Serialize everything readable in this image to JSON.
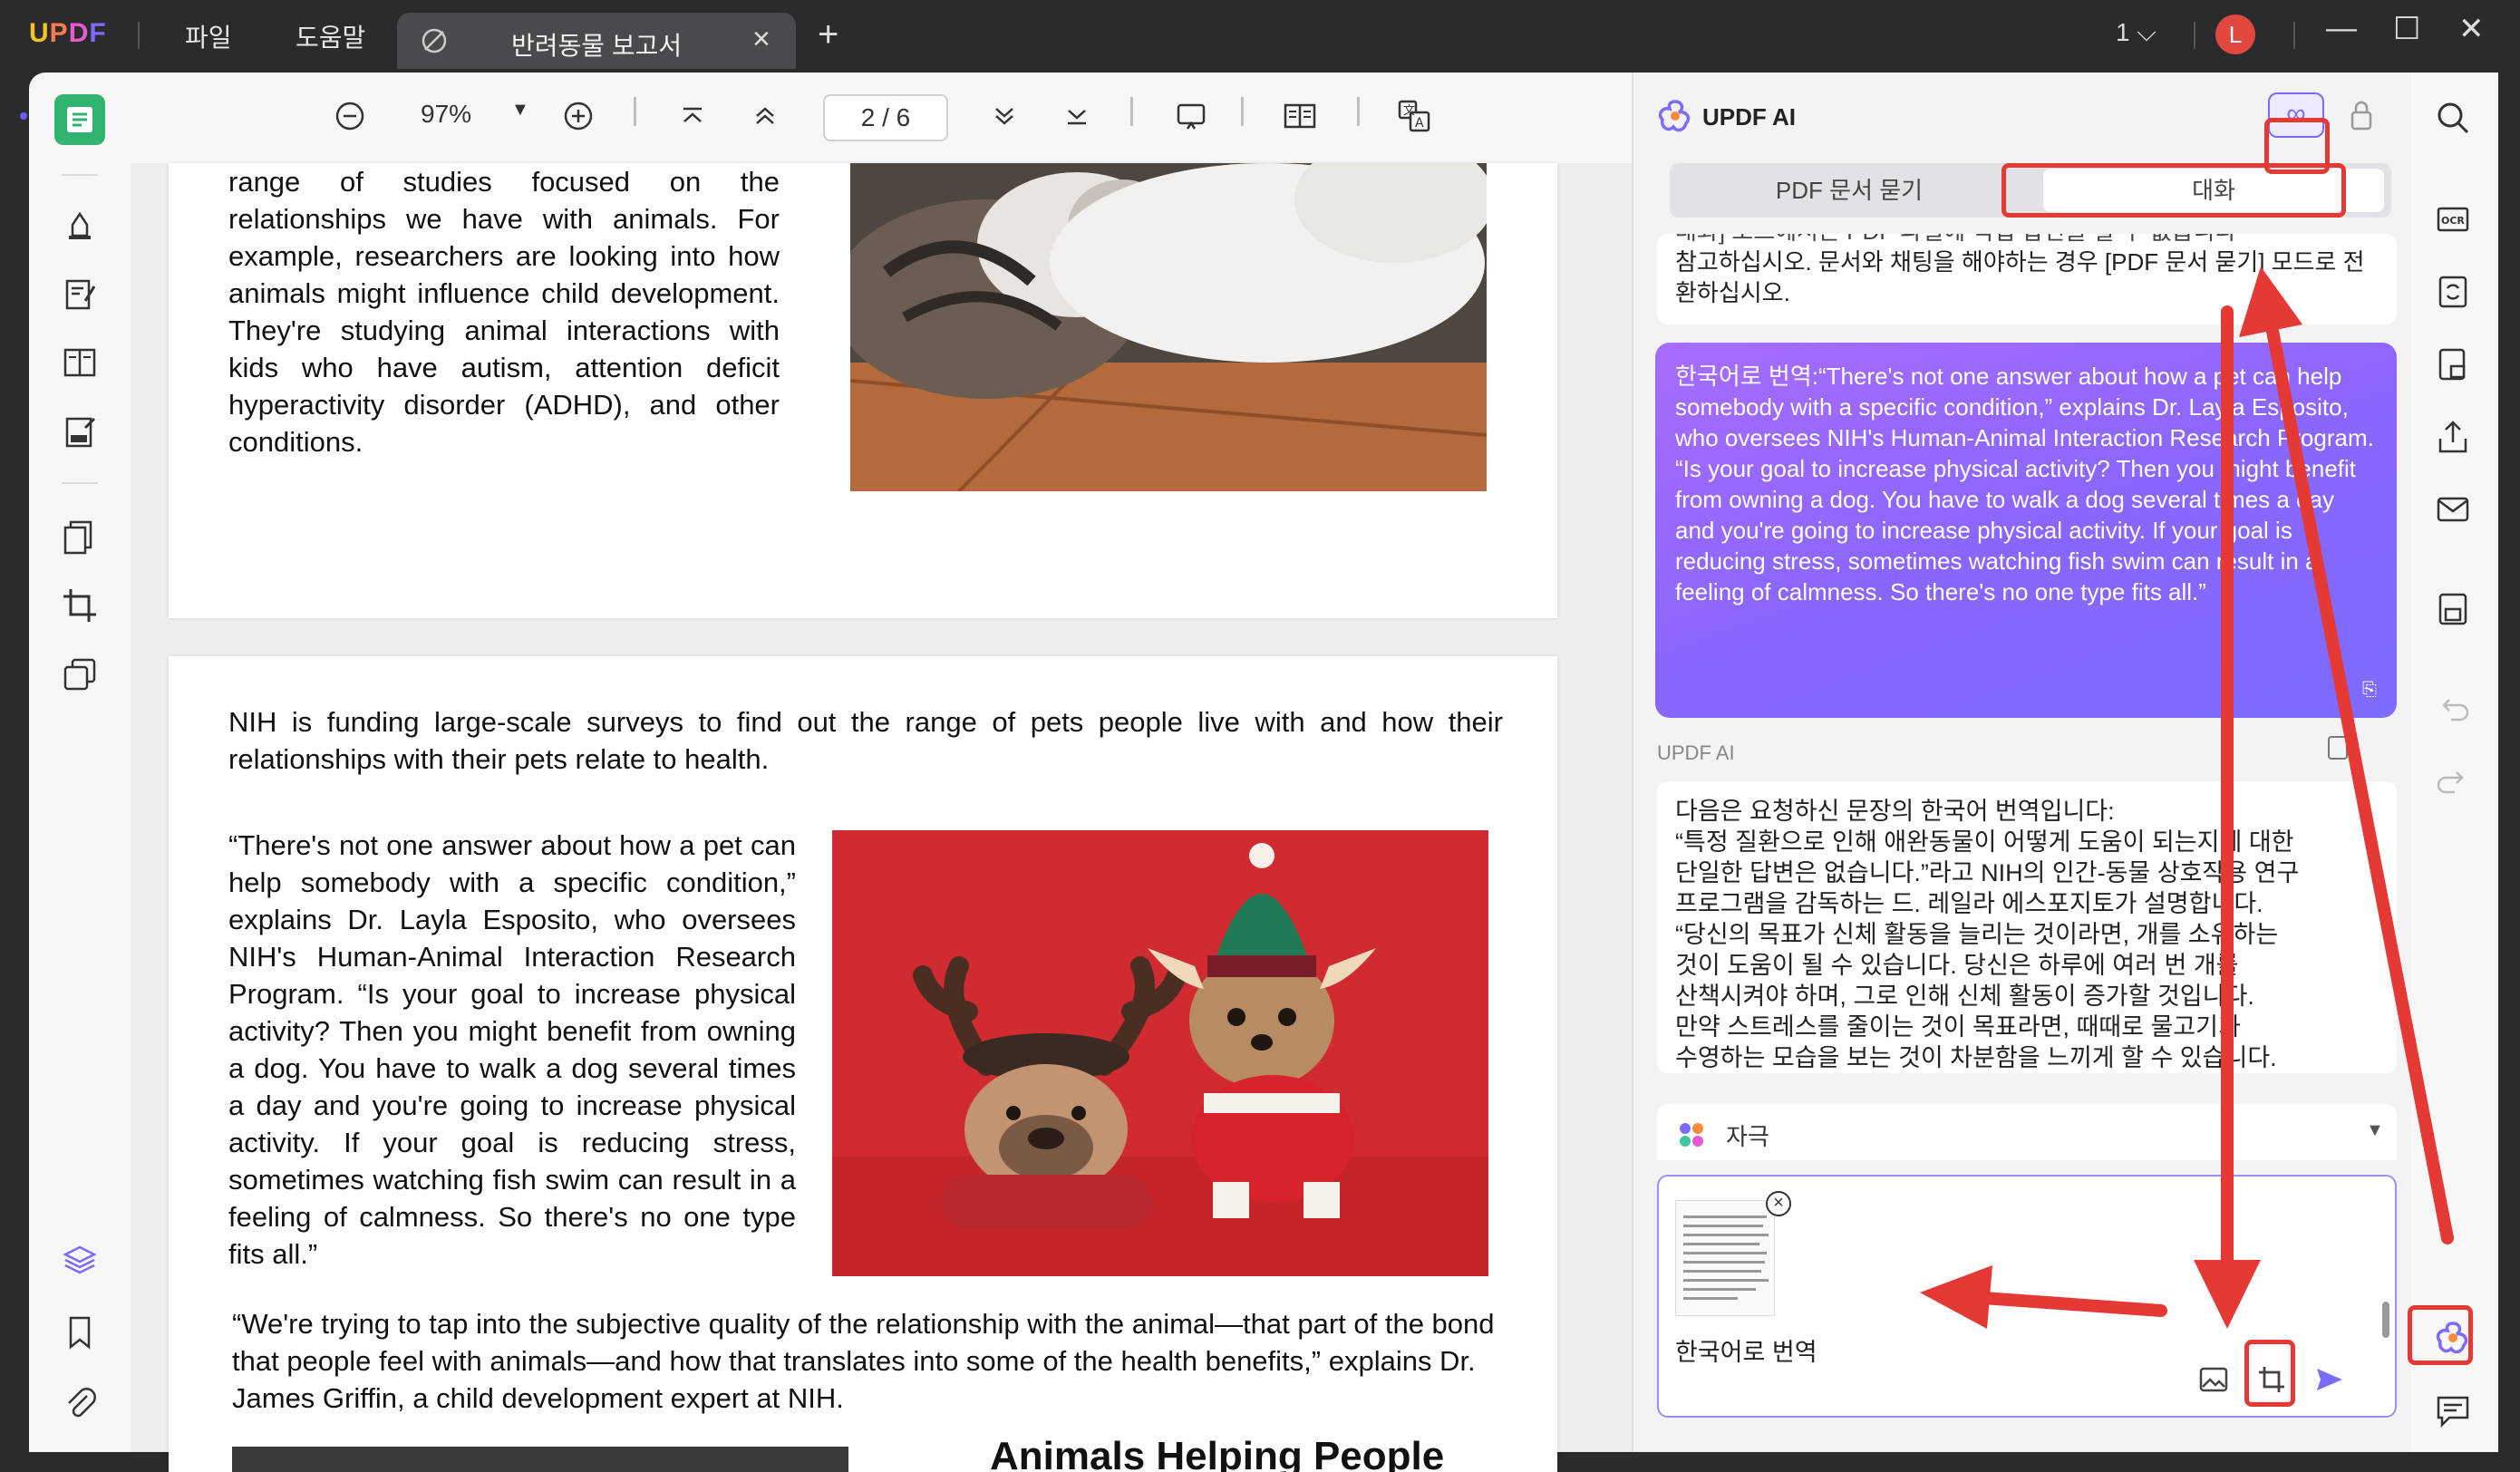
{
  "app": {
    "brand": "UPDF",
    "menu": [
      "파일",
      "도움말"
    ],
    "tab_title": "반려동물 보고서",
    "tab_close": "×",
    "new_tab": "+",
    "page_selector": "1",
    "avatar_letter": "L"
  },
  "toolbar": {
    "zoom": "97%",
    "page_indicator": "2 / 6"
  },
  "document": {
    "para1": "range of studies focused on the relationships we have with animals. For example, researchers are looking into how animals might influence child development. They're studying animal interactions with kids who have autism, attention deficit hyperactivity disorder (ADHD), and other conditions.",
    "para2": "NIH is funding large-scale surveys to find out the range of pets people live with and how their relationships with their pets relate to health.",
    "para3": "“There's not one answer about how a pet can help somebody with a specific condition,” explains Dr. Layla Esposito, who oversees NIH's Human-Animal Interaction Research Program. “Is your goal to increase physical activity? Then you might benefit from owning a dog. You have to walk a dog several times a day and you're going to increase physical activity. If your goal is reducing stress, sometimes watching fish swim can result in a feeling of calmness. So there's no one type fits all.”",
    "para4": "“We're trying to tap into the subjective quality of the relationship with the animal—that part of the bond that people feel with animals—and how that translates into some of the health benefits,” explains Dr. James Griffin, a child development expert at NIH.",
    "heading": "Animals Helping People"
  },
  "ai_panel": {
    "title": "UPDF AI",
    "tab_pdf": "PDF 문서 묻기",
    "tab_chat": "대화",
    "prev_message_top": "대화] 모드에서는 PDF 파일에 직접 답변을 할 수 없습니다",
    "prev_message": "참고하십시오. 문서와 채팅을 해야하는 경우 [PDF 문서 묻기] 모드로 전환하십시오.",
    "user_message": "한국어로 번역:“There's not one answer about how a pet can help somebody with a specific condition,” explains Dr. Layla Esposito, who oversees NIH's Human-Animal Interaction Research Program. “Is your goal to increase physical activity? Then you might benefit from owning a dog. You have to walk a dog several times a day and you're going to increase physical activity. If your goal is reducing stress, sometimes watching fish swim can result in a feeling of calmness. So there's no one type fits all.”",
    "ai_label": "UPDF AI",
    "reply_lines": [
      "다음은 요청하신 문장의 한국어 번역입니다:",
      "“특정 질환으로 인해 애완동물이 어떻게 도움이 되는지에 대한",
      "단일한 답변은 없습니다.”라고 NIH의 인간-동물 상호작용 연구",
      "프로그램을 감독하는 드. 레일라 에스포지토가 설명합니다.",
      "“당신의 목표가 신체 활동을 늘리는 것이라면, 개를 소유하는",
      "것이 도움이 될 수 있습니다. 당신은 하루에 여러 번 개를",
      "산책시켜야 하며, 그로 인해 신체 활동이 증가할 것입니다.",
      "만약 스트레스를 줄이는 것이 목표라면, 때때로 물고기가",
      "수영하는 모습을 보는 것이 차분함을 느끼게 할 수 있습니다."
    ],
    "prompt_label": "자극",
    "input_text": "한국어로 번역",
    "thumb_close": "×"
  },
  "colors": {
    "accent": "#7b6cff",
    "active_tool": "#2fb36e",
    "annotation": "#e53935"
  }
}
